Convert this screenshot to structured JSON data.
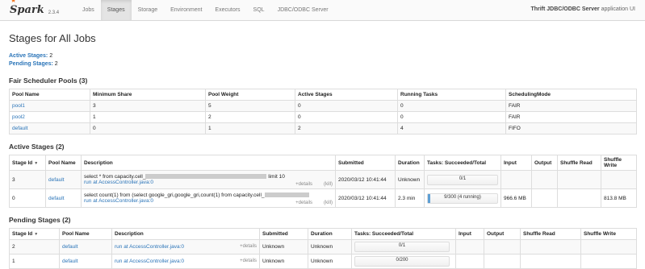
{
  "header": {
    "logo_text": "Spark",
    "version": "2.3.4",
    "nav": [
      "Jobs",
      "Stages",
      "Storage",
      "Environment",
      "Executors",
      "SQL",
      "JDBC/ODBC Server"
    ],
    "active_index": 1,
    "app_name_bold": "Thrift JDBC/ODBC Server",
    "app_name_suffix": " application UI"
  },
  "page": {
    "title": "Stages for All Jobs",
    "active_label": "Active Stages:",
    "active_count": "2",
    "pending_label": "Pending Stages:",
    "pending_count": "2"
  },
  "pools": {
    "title": "Fair Scheduler Pools (3)",
    "headers": [
      "Pool Name",
      "Minimum Share",
      "Pool Weight",
      "Active Stages",
      "Running Tasks",
      "SchedulingMode"
    ],
    "rows": [
      [
        "pool1",
        "3",
        "5",
        "0",
        "0",
        "FAIR"
      ],
      [
        "pool2",
        "1",
        "2",
        "0",
        "0",
        "FAIR"
      ],
      [
        "default",
        "0",
        "1",
        "2",
        "4",
        "FIFO"
      ]
    ]
  },
  "active": {
    "title": "Active Stages (2)",
    "headers": [
      "Stage Id",
      "Pool Name",
      "Description",
      "Submitted",
      "Duration",
      "Tasks: Succeeded/Total",
      "Input",
      "Output",
      "Shuffle Read",
      "Shuffle Write"
    ],
    "details_label": "+details",
    "kill_label": "(kill)",
    "rows": [
      {
        "id": "3",
        "pool": "default",
        "desc": "select * from capacity.cell_",
        "desc_tail": "limit 10",
        "sub": "run at AccessController.java:0",
        "submitted": "2020/03/12 10:41:44",
        "duration": "Unknown",
        "tasks": "0/1",
        "progress": 0.0,
        "input": "",
        "output": "",
        "sread": "",
        "swrite": ""
      },
      {
        "id": "0",
        "pool": "default",
        "desc": "select count(1) from (select google_gri,google_gri,count(1) from capacity.cell_",
        "desc_tail": "",
        "sub": "run at AccessController.java:0",
        "submitted": "2020/03/12 10:41:44",
        "duration": "2.3 min",
        "tasks": "9/300 (4 running)",
        "progress": 0.03,
        "input": "966.6 MB",
        "output": "",
        "sread": "",
        "swrite": "813.8 MB"
      }
    ]
  },
  "pending": {
    "title": "Pending Stages (2)",
    "headers": [
      "Stage Id",
      "Pool Name",
      "Description",
      "Submitted",
      "Duration",
      "Tasks: Succeeded/Total",
      "Input",
      "Output",
      "Shuffle Read",
      "Shuffle Write"
    ],
    "details_label": "+details",
    "rows": [
      {
        "id": "2",
        "pool": "default",
        "desc": "run at AccessController.java:0",
        "submitted": "Unknown",
        "duration": "Unknown",
        "tasks": "0/1"
      },
      {
        "id": "1",
        "pool": "default",
        "desc": "run at AccessController.java:0",
        "submitted": "Unknown",
        "duration": "Unknown",
        "tasks": "0/200"
      }
    ]
  }
}
